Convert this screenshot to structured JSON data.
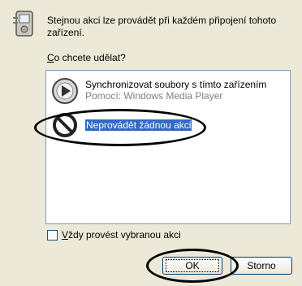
{
  "description": "Stejnou akci lze provádět při každém připojení tohoto zařízení.",
  "question": {
    "underlined": "C",
    "rest": "o chcete udělat?"
  },
  "actions": [
    {
      "title": "Synchronizovat soubory s tímto zařízením",
      "subtitle": "Pomocí: Windows Media Player",
      "icon": "media-player-icon"
    },
    {
      "title": "Neprovádět žádnou akci",
      "icon": "no-action-icon",
      "selected": true
    }
  ],
  "always_checkbox": {
    "underlined": "V",
    "rest": "ždy provést vybranou akci",
    "checked": false
  },
  "buttons": {
    "ok": "OK",
    "cancel": "Storno"
  },
  "colors": {
    "selection": "#316ac5",
    "background": "#ece9d8",
    "list_border": "#7f9db9"
  }
}
